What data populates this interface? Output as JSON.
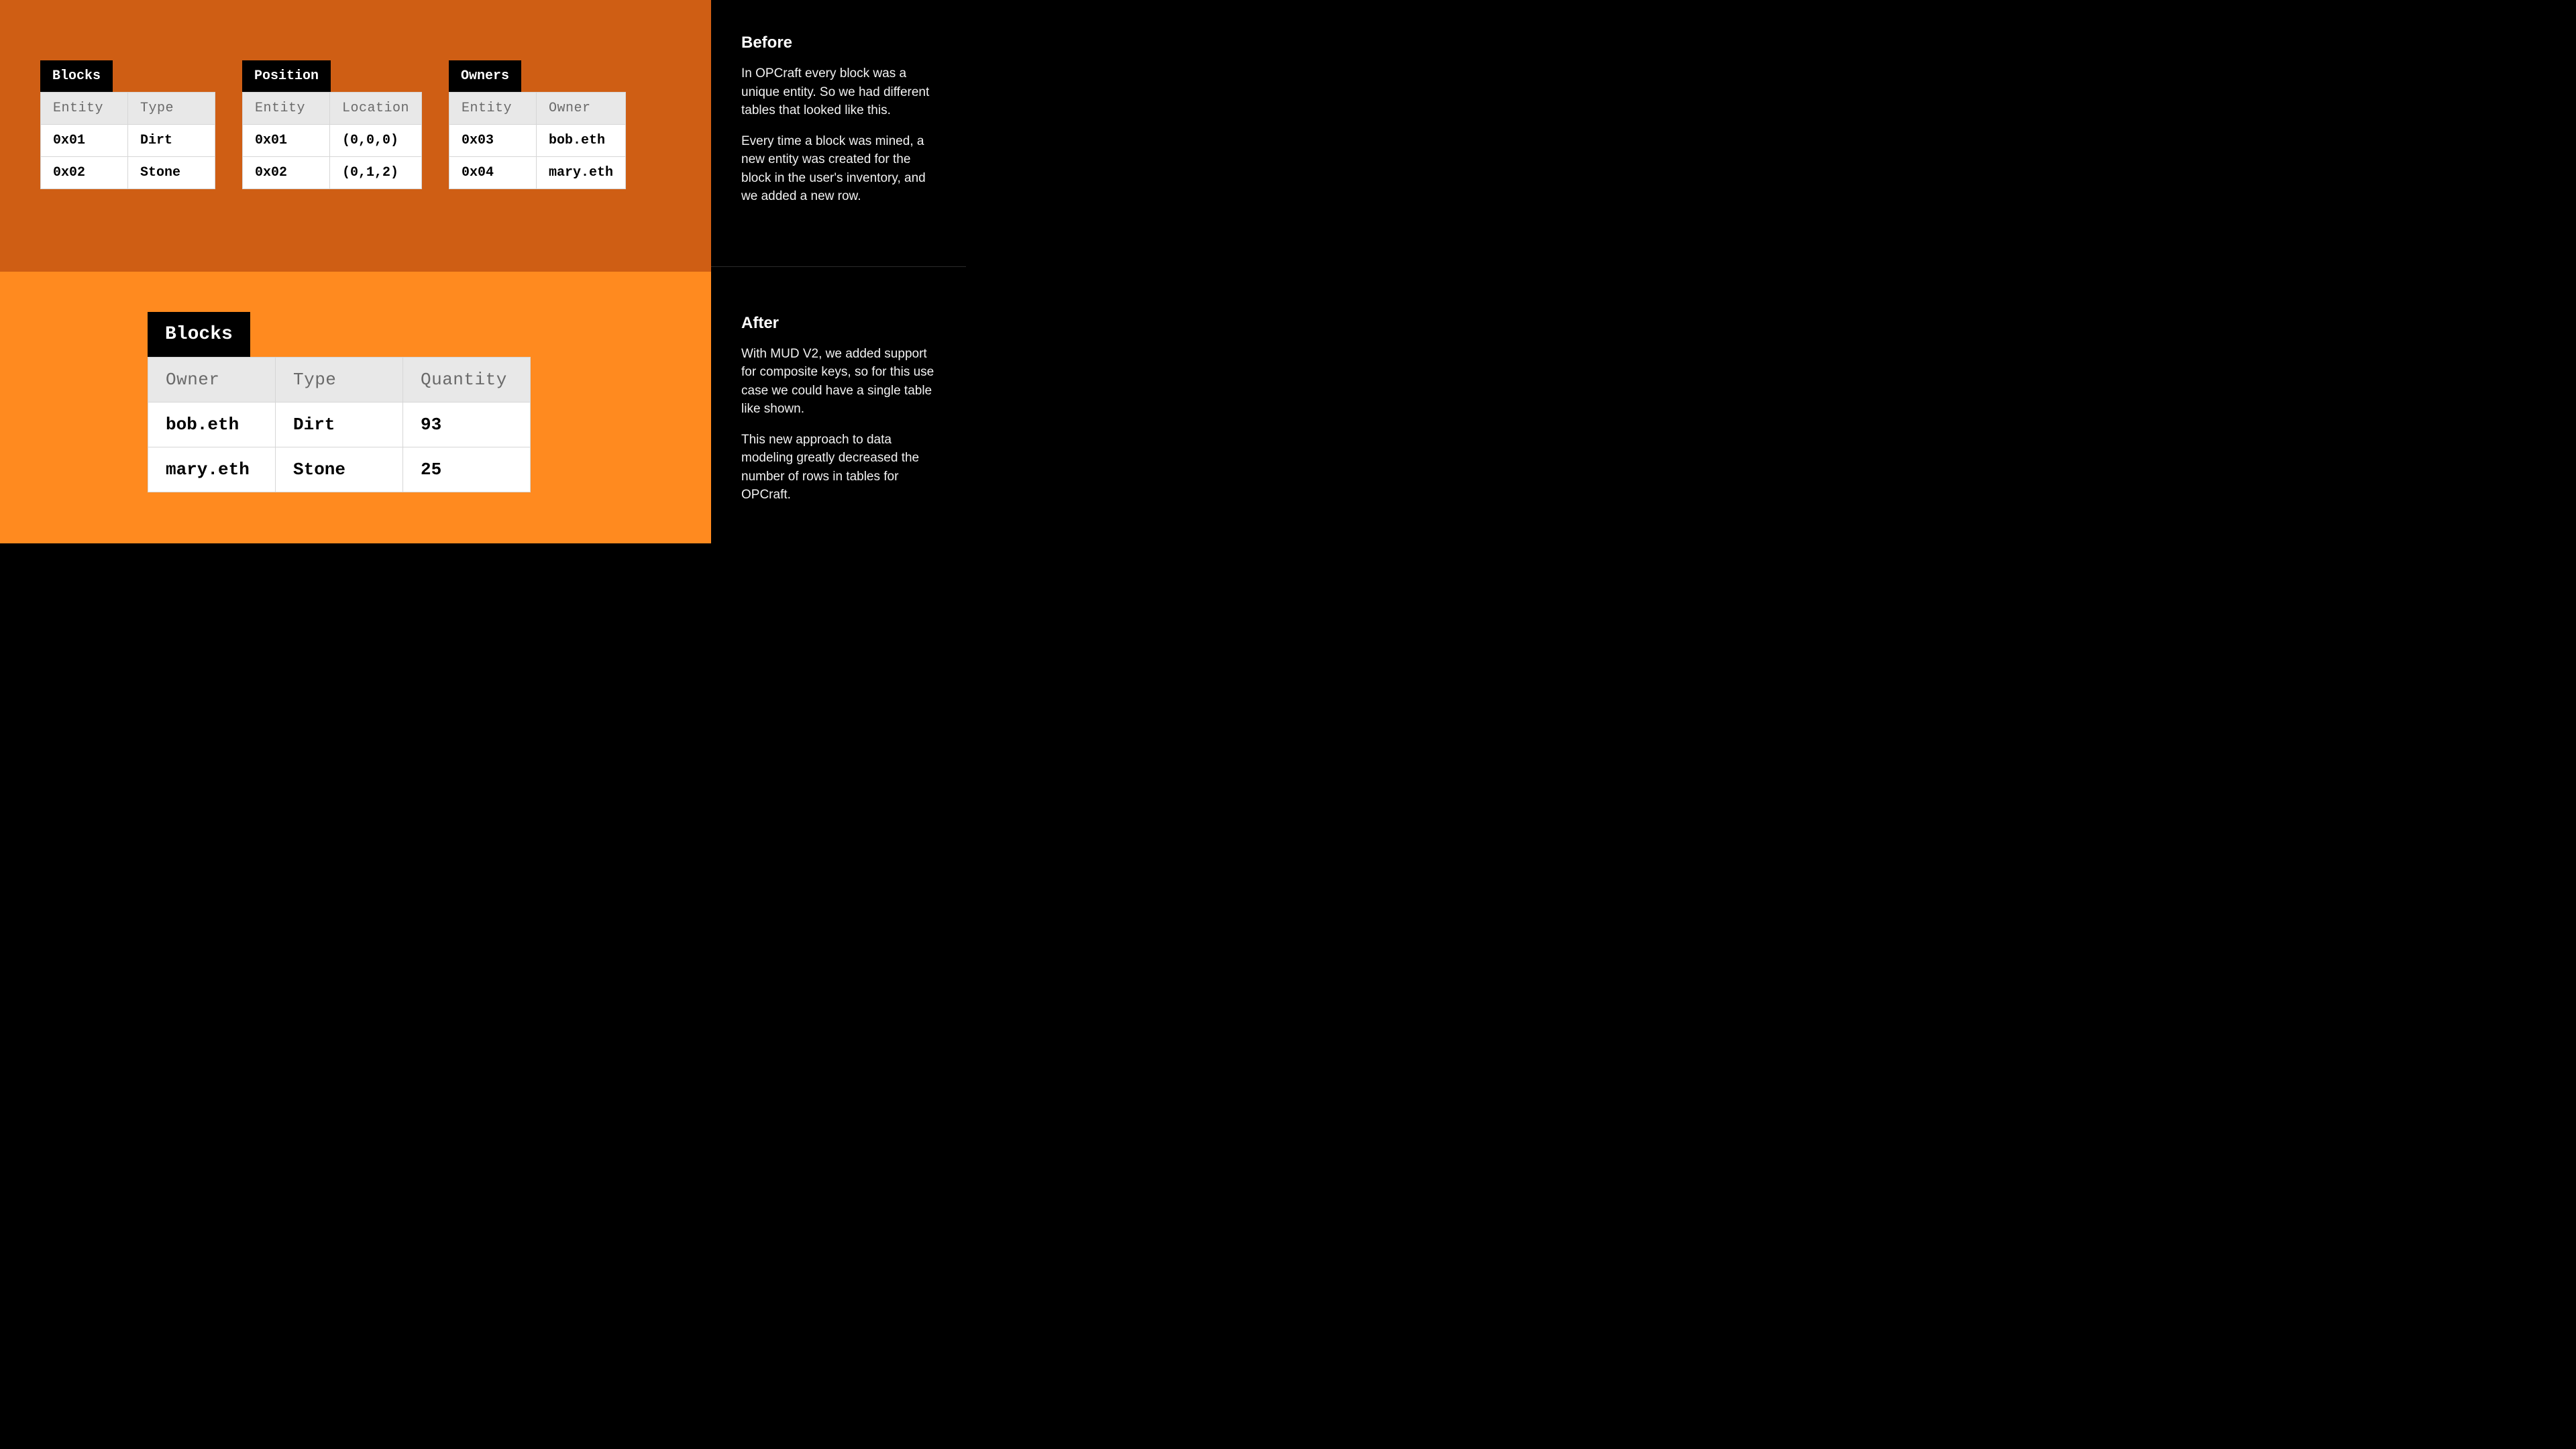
{
  "before": {
    "heading": "Before",
    "para1": "In OPCraft every block was a unique entity. So we had different tables that looked like this.",
    "para2": "Every time a block was mined, a new entity was created for the block in the user's inventory, and we added a new row.",
    "tables": {
      "blocks": {
        "title": "Blocks",
        "cols": [
          "Entity",
          "Type"
        ],
        "rows": [
          [
            "0x01",
            "Dirt"
          ],
          [
            "0x02",
            "Stone"
          ]
        ]
      },
      "position": {
        "title": "Position",
        "cols": [
          "Entity",
          "Location"
        ],
        "rows": [
          [
            "0x01",
            "(0,0,0)"
          ],
          [
            "0x02",
            "(0,1,2)"
          ]
        ]
      },
      "owners": {
        "title": "Owners",
        "cols": [
          "Entity",
          "Owner"
        ],
        "rows": [
          [
            "0x03",
            "bob.eth"
          ],
          [
            "0x04",
            "mary.eth"
          ]
        ]
      }
    }
  },
  "after": {
    "heading": "After",
    "para1": "With MUD V2, we added support for composite keys, so for this use case we could have a single table like shown.",
    "para2": "This new approach to data modeling greatly decreased the number of rows in tables for OPCraft.",
    "table": {
      "title": "Blocks",
      "cols": [
        "Owner",
        "Type",
        "Quantity"
      ],
      "rows": [
        [
          "bob.eth",
          "Dirt",
          "93"
        ],
        [
          "mary.eth",
          "Stone",
          "25"
        ]
      ]
    }
  }
}
